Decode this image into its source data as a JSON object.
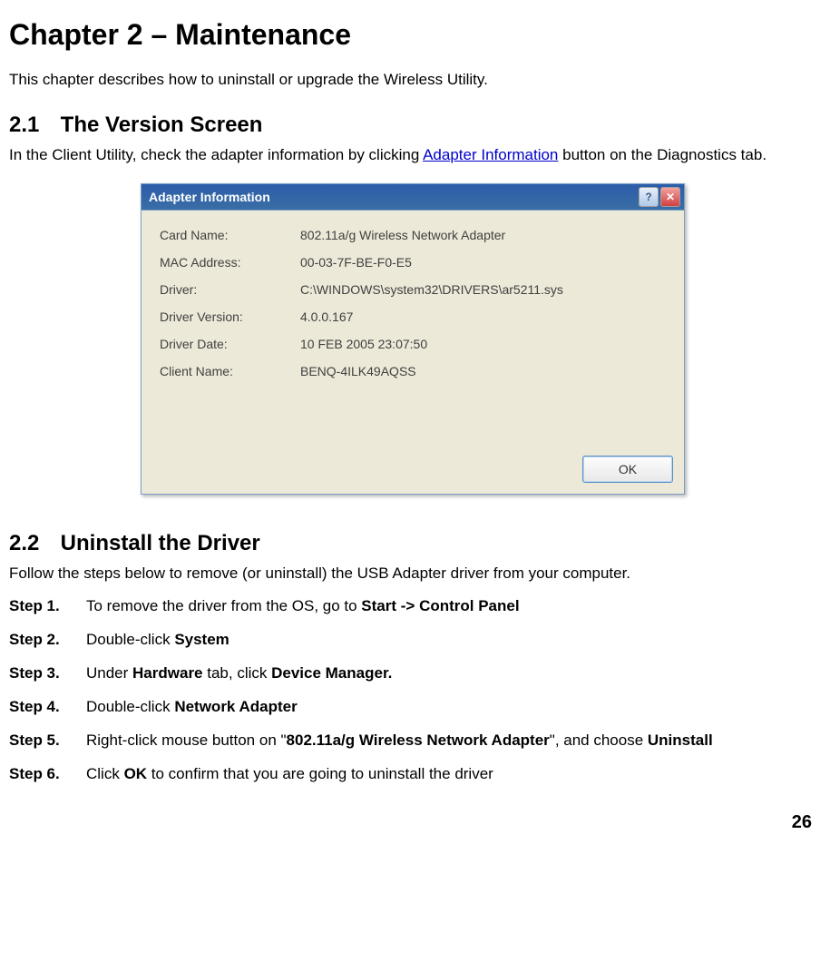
{
  "chapter_title": "Chapter 2 – Maintenance",
  "intro_paragraph": "This chapter describes how to uninstall or upgrade the Wireless Utility.",
  "section_2_1": {
    "number": "2.1",
    "title": "The Version Screen",
    "text_prefix": "In the Client Utility, check the adapter information by clicking ",
    "link_text": "Adapter Information",
    "text_suffix": " button on the Diagnostics tab."
  },
  "dialog": {
    "title": "Adapter Information",
    "help_icon": "?",
    "close_icon": "✕",
    "rows": [
      {
        "label": "Card Name:",
        "value": "802.11a/g Wireless Network Adapter"
      },
      {
        "label": "MAC Address:",
        "value": "00-03-7F-BE-F0-E5"
      },
      {
        "label": "Driver:",
        "value": "C:\\WINDOWS\\system32\\DRIVERS\\ar5211.sys"
      },
      {
        "label": "Driver Version:",
        "value": "4.0.0.167"
      },
      {
        "label": "Driver Date:",
        "value": "10 FEB 2005 23:07:50"
      },
      {
        "label": "Client Name:",
        "value": "BENQ-4ILK49AQSS"
      }
    ],
    "ok_label": "OK"
  },
  "section_2_2": {
    "number": "2.2",
    "title": "Uninstall the Driver",
    "intro": "Follow the steps below to remove (or uninstall) the USB Adapter driver from your computer.",
    "steps": [
      {
        "label": "Step 1.",
        "text_before": "To remove the driver from the OS, go to ",
        "bold": "Start -> Control Panel",
        "text_after": ""
      },
      {
        "label": "Step 2.",
        "text_before": "Double-click ",
        "bold": "System",
        "text_after": ""
      },
      {
        "label": "Step 3.",
        "text_before": "Under ",
        "bold": "Hardware",
        "text_mid": " tab, click ",
        "bold2": "Device Manager.",
        "text_after": ""
      },
      {
        "label": "Step 4.",
        "text_before": "Double-click ",
        "bold": "Network Adapter",
        "text_after": ""
      },
      {
        "label": "Step 5.",
        "text_before": "Right-click mouse button on \"",
        "bold": "802.11a/g Wireless Network Adapter",
        "text_mid": "\", and choose ",
        "bold2": "Uninstall",
        "text_after": ""
      },
      {
        "label": "Step 6.",
        "text_before": "Click ",
        "bold": "OK",
        "text_after": " to confirm that you are going to uninstall the driver"
      }
    ]
  },
  "page_number": "26"
}
